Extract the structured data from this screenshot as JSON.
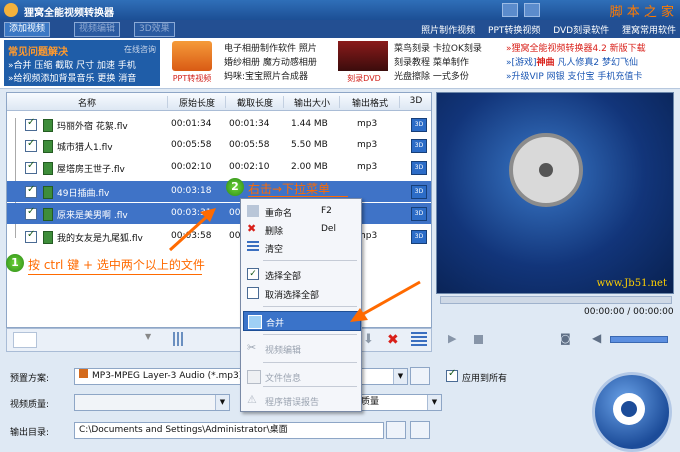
{
  "app": {
    "title": "狸窝全能视频转换器",
    "watermark": "脚 本 之 家"
  },
  "menubar": {
    "tabs": [
      {
        "label": "添加视频",
        "state": "active"
      },
      {
        "label": "视频编辑",
        "state": "inactive"
      },
      {
        "label": "3D效果",
        "state": "inactive"
      }
    ],
    "links": [
      "照片制作视频",
      "PPT转换视频",
      "DVD刻录软件",
      "狸窝常用软件"
    ]
  },
  "banner": {
    "faq_title": "常见问题解决",
    "faq_online": "在线咨询",
    "faq_line1": "»合并 压缩 截取 尺寸 加速 手机",
    "faq_line2": "»给视频添加背景音乐 更换 消音",
    "ppt_label": "PPT转视频",
    "col1": [
      "电子相册制作软件 照片",
      "婚纱相册 魔方动感相册",
      "妈咪:宝宝照片合成器"
    ],
    "dvd_label": "刻录DVD",
    "col2": [
      "菜鸟刻录 卡拉OK刻录",
      "刻录教程 菜单制作",
      "光盘擦除 一式多份"
    ],
    "col3_line1_red": "»狸窝全能视频转换器4.2 新版下载",
    "col3_line2_prefix": "»[游戏]",
    "col3_line2_bold": "神曲",
    "col3_line2_rest": "凡人修真2 梦幻飞仙",
    "col3_line3": "»升级VIP 网银 支付宝 手机充值卡"
  },
  "filelist": {
    "headers": [
      "名称",
      "原始长度",
      "截取长度",
      "输出大小",
      "输出格式",
      "3D"
    ],
    "rows": [
      {
        "name": "玛丽外宿 花絮.flv",
        "orig": "00:01:34",
        "cut": "00:01:34",
        "size": "1.44 MB",
        "fmt": "mp3",
        "selected": false
      },
      {
        "name": "城市猎人1.flv",
        "orig": "00:05:58",
        "cut": "00:05:58",
        "size": "5.50 MB",
        "fmt": "mp3",
        "selected": false
      },
      {
        "name": "屋塔房王世子.flv",
        "orig": "00:02:10",
        "cut": "00:02:10",
        "size": "2.00 MB",
        "fmt": "mp3",
        "selected": false
      },
      {
        "name": "49日插曲.flv",
        "orig": "00:03:18",
        "cut": "",
        "size": "",
        "fmt": "",
        "selected": true
      },
      {
        "name": "原来是美男啊",
        "name_tail": ".flv",
        "orig": "00:03:31",
        "cut": "00",
        "size": "",
        "fmt": "",
        "selected": true
      },
      {
        "name": "我的女友是九尾狐.flv",
        "orig": "00:03:58",
        "cut": "00",
        "size": "",
        "fmt": "mp3",
        "selected": false
      }
    ]
  },
  "context_menu": {
    "items": [
      {
        "label": "重命名",
        "shortcut": "F2",
        "icon": "rename-icon",
        "disabled": false,
        "highlighted": false
      },
      {
        "label": "删除",
        "shortcut": "Del",
        "icon": "delete-x-icon",
        "disabled": false,
        "highlighted": false
      },
      {
        "label": "清空",
        "shortcut": "",
        "icon": "clear-list-icon",
        "disabled": false,
        "highlighted": false
      },
      {
        "label": "选择全部",
        "shortcut": "",
        "icon": "checkbox-checked-icon",
        "disabled": false,
        "highlighted": false
      },
      {
        "label": "取消选择全部",
        "shortcut": "",
        "icon": "checkbox-empty-icon",
        "disabled": false,
        "highlighted": false
      },
      {
        "label": "合并",
        "shortcut": "",
        "icon": "merge-icon",
        "disabled": false,
        "highlighted": true
      },
      {
        "label": "视频编辑",
        "shortcut": "",
        "icon": "scissors-icon",
        "disabled": true,
        "highlighted": false
      },
      {
        "label": "文件信息",
        "shortcut": "",
        "icon": "file-info-icon",
        "disabled": true,
        "highlighted": false
      },
      {
        "label": "程序错误报告",
        "shortcut": "",
        "icon": "warning-icon",
        "disabled": true,
        "highlighted": false
      }
    ]
  },
  "annotations": {
    "step1_num": "1",
    "step1_text": "按 ctrl 键 + 选中两个以上的文件",
    "step2_num": "2",
    "step2_text": "右击→下拉菜单"
  },
  "preview": {
    "timecode": "00:00:00 / 00:00:00",
    "watermark": "www.Jb51.net"
  },
  "bottom": {
    "preset_label": "预置方案:",
    "preset_value": "MP3-MPEG Layer-3 Audio (*.mp3)",
    "apply_all_label": "应用到所有",
    "quality_label": "视频质量:",
    "audio_quality_value": "质量",
    "output_label": "输出目录:",
    "output_value": "C:\\Documents and Settings\\Administrator\\桌面"
  },
  "colors": {
    "accent_blue": "#1f5da8",
    "selection": "#3f73c7",
    "annotation_orange": "#ff6a00",
    "annotation_green": "#3aa81e"
  }
}
